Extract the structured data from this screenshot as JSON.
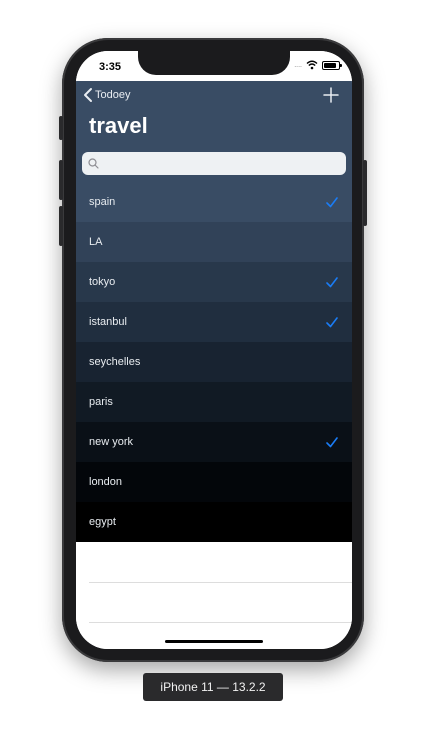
{
  "device": {
    "label": "iPhone 11 — 13.2.2"
  },
  "status_bar": {
    "time": "3:35",
    "signal": "....",
    "wifi_icon": "wifi-icon",
    "battery_icon": "battery-icon"
  },
  "nav": {
    "back_label": "Todoey",
    "back_icon": "chevron-left-icon",
    "add_icon": "plus-icon",
    "title": "travel"
  },
  "search": {
    "placeholder": "",
    "value": "",
    "icon": "search-icon"
  },
  "items": [
    {
      "title": "spain",
      "done": true,
      "bg": "#394c64"
    },
    {
      "title": "LA",
      "done": false,
      "bg": "#314258"
    },
    {
      "title": "tokyo",
      "done": true,
      "bg": "#28384b"
    },
    {
      "title": "istanbul",
      "done": true,
      "bg": "#202e3f"
    },
    {
      "title": "seychelles",
      "done": false,
      "bg": "#182331"
    },
    {
      "title": "paris",
      "done": false,
      "bg": "#111a24"
    },
    {
      "title": "new york",
      "done": true,
      "bg": "#0a1017"
    },
    {
      "title": "london",
      "done": false,
      "bg": "#03060a"
    },
    {
      "title": "egypt",
      "done": false,
      "bg": "#000000"
    }
  ],
  "colors": {
    "nav_bg": "#394c64",
    "checkmark": "#1a7cf5"
  }
}
